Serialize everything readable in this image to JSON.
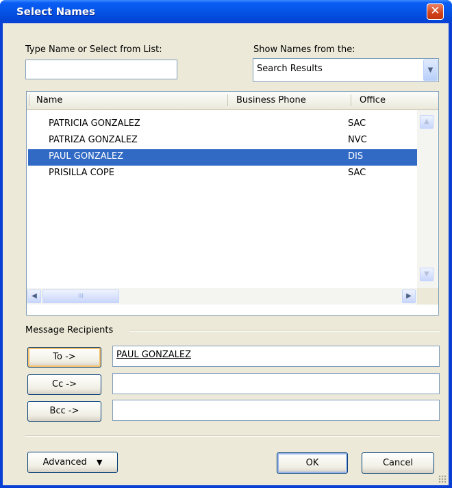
{
  "window": {
    "title": "Select Names",
    "close_label": "✕"
  },
  "search": {
    "label": "Type Name or Select from List:",
    "value": ""
  },
  "source": {
    "label": "Show Names from the:",
    "selected": "Search Results"
  },
  "list": {
    "columns": [
      "Name",
      "Business Phone",
      "Office"
    ],
    "rows": [
      {
        "name": "PATRICIA GONZALEZ",
        "phone": "",
        "office": "SAC",
        "selected": false
      },
      {
        "name": "PATRIZA GONZALEZ",
        "phone": "",
        "office": "NVC",
        "selected": false
      },
      {
        "name": "PAUL GONZALEZ",
        "phone": "",
        "office": "DIS",
        "selected": true
      },
      {
        "name": "PRISILLA COPE",
        "phone": "",
        "office": "SAC",
        "selected": false
      }
    ],
    "hscroll_thumb_glyph": "III"
  },
  "recipients": {
    "group_label": "Message Recipients",
    "to": {
      "button": "To ->",
      "value": "PAUL GONZALEZ"
    },
    "cc": {
      "button": "Cc ->",
      "value": ""
    },
    "bcc": {
      "button": "Bcc ->",
      "value": ""
    }
  },
  "footer": {
    "advanced_label": "Advanced",
    "ok_label": "OK",
    "cancel_label": "Cancel"
  },
  "colors": {
    "title_bar": "#0a5ef5",
    "selection": "#316ac5",
    "dialog_bg": "#ece9d8"
  }
}
